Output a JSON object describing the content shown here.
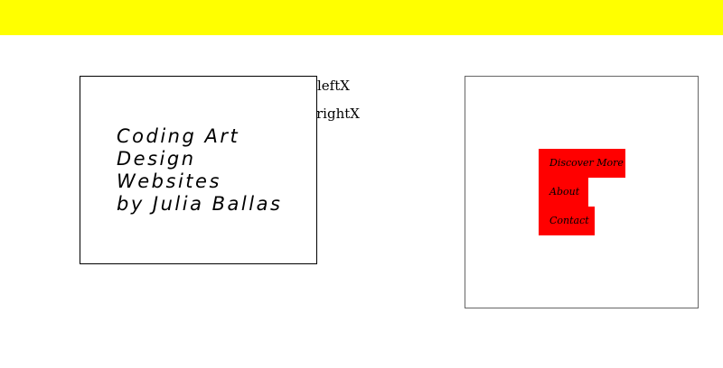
{
  "banner": {
    "color": "#ffff00"
  },
  "title": {
    "lines": [
      "Coding Art",
      "Design",
      "Websites",
      "by Julia Ballas"
    ]
  },
  "labels": {
    "left": "leftX",
    "right": "rightX"
  },
  "menu": {
    "accent_color": "#ff0000",
    "items": [
      {
        "label": "Discover More"
      },
      {
        "label": "About"
      },
      {
        "label": "Contact"
      }
    ]
  }
}
